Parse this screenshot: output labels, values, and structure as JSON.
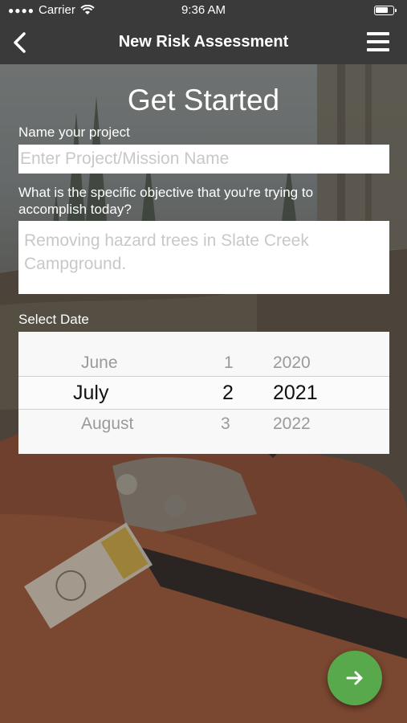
{
  "status_bar": {
    "carrier": "Carrier",
    "time": "9:36 AM"
  },
  "nav": {
    "title": "New Risk Assessment",
    "back_icon": "chevron-left-icon",
    "menu_icon": "hamburger-menu-icon"
  },
  "form": {
    "heading": "Get Started",
    "project_label": "Name your project",
    "project_placeholder": "Enter Project/Mission Name",
    "project_value": "",
    "objective_label": "What is the specific objective that you're trying to accomplish today?",
    "objective_placeholder": "Removing hazard trees in Slate Creek Campground.",
    "objective_value": "",
    "date_label": "Select Date"
  },
  "date_picker": {
    "month": {
      "prev": "June",
      "selected": "July",
      "next": "August"
    },
    "day": {
      "prev": "1",
      "selected": "2",
      "next": "3"
    },
    "year": {
      "prev": "2020",
      "selected": "2021",
      "next": "2022"
    }
  },
  "next_button": {
    "icon": "arrow-right-icon"
  },
  "colors": {
    "nav_background": "#3a3a3a",
    "accent_green": "#58a94c",
    "picker_background": "#f8f8f8"
  }
}
